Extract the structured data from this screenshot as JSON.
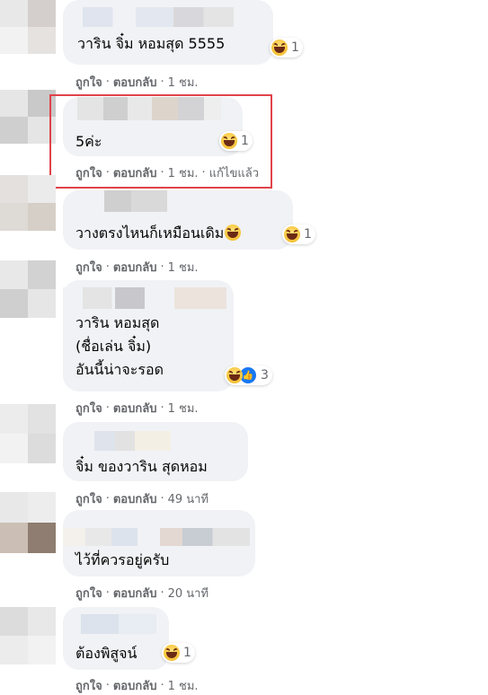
{
  "comments": [
    {
      "text": "วาริน จิ๋ม หอมสุด 5555",
      "reaction_count": "1",
      "like": "ถูกใจ",
      "reply": "ตอบกลับ",
      "time": "1 ชม.",
      "edited": ""
    },
    {
      "text": "5ค่ะ",
      "reaction_count": "1",
      "like": "ถูกใจ",
      "reply": "ตอบกลับ",
      "time": "1 ชม.",
      "edited": "แก้ไขแล้ว"
    },
    {
      "text": "วางตรงไหนก็เหมือนเดิม",
      "reaction_count": "1",
      "like": "ถูกใจ",
      "reply": "ตอบกลับ",
      "time": "1 ชม.",
      "edited": ""
    },
    {
      "lines": [
        "วาริน หอมสุด",
        "(ชื่อเล่น จิ๋ม)",
        "อันนี้น่าจะรอด"
      ],
      "reaction_count": "3",
      "like": "ถูกใจ",
      "reply": "ตอบกลับ",
      "time": "1 ชม.",
      "edited": ""
    },
    {
      "text": "จิ๋ม ของวาริน สุดหอม",
      "reaction_count": "",
      "like": "ถูกใจ",
      "reply": "ตอบกลับ",
      "time": "49 นาที",
      "edited": ""
    },
    {
      "text": "ไว้ที่ควรอยู่ครับ",
      "reaction_count": "",
      "like": "ถูกใจ",
      "reply": "ตอบกลับ",
      "time": "20 นาที",
      "edited": ""
    },
    {
      "text": "ต้องพิสูจน์",
      "reaction_count": "1",
      "like": "ถูกใจ",
      "reply": "ตอบกลับ",
      "time": "1 ชม.",
      "edited": ""
    }
  ],
  "separator": "·",
  "colors": {
    "bubble": "#f0f2f5",
    "meta": "#65676b",
    "highlight": "#e0434a",
    "like_blue": "#1877f2"
  }
}
